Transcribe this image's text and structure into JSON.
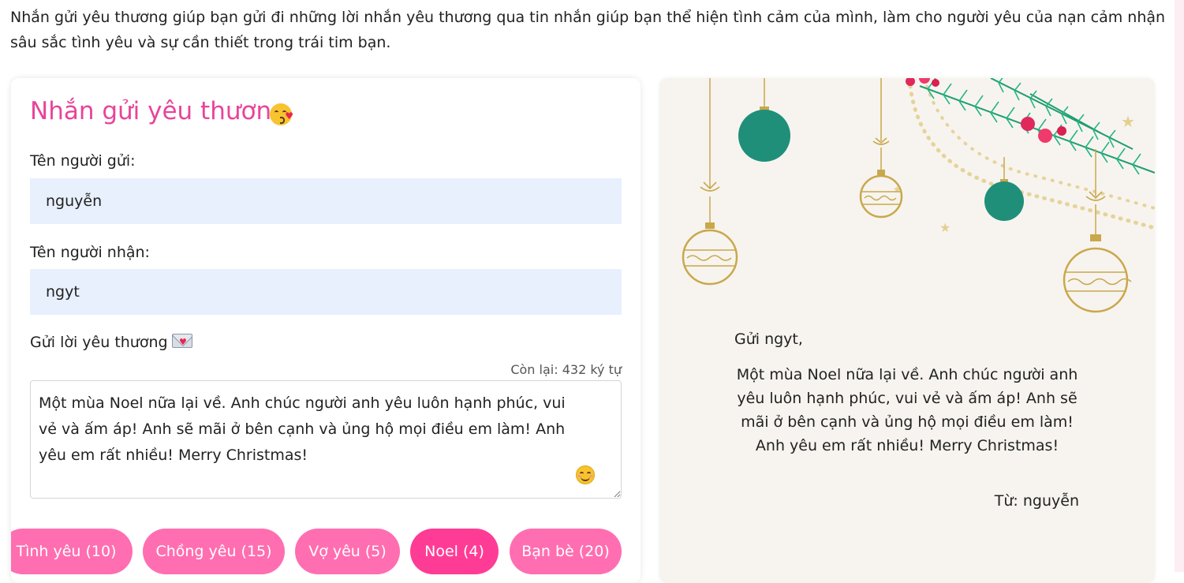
{
  "intro_text": "Nhắn gửi yêu thương giúp bạn gửi đi những lời nhắn yêu thương qua tin nhắn giúp bạn thể hiện tình cảm của mình, làm cho người yêu của nạn cảm nhận sâu sắc tình yêu và sự cần thiết trong trái tim bạn.",
  "form": {
    "title": "Nhắn gửi yêu thương",
    "title_emoji": "kissing-face-icon",
    "sender_label": "Tên người gửi:",
    "sender_value": "nguyễn",
    "receiver_label": "Tên người nhận:",
    "receiver_value": "ngyt",
    "message_label": "Gửi lời yêu thương",
    "message_icon": "love-letter-icon",
    "counter": "Còn lại: 432 ký tự",
    "message_value": "Một mùa Noel nữa lại về. Anh chúc người anh yêu luôn hạnh phúc, vui vẻ và ấm áp! Anh sẽ mãi ở bên cạnh và ủng hộ mọi điều em làm! Anh yêu em rất nhiều! Merry Christmas!",
    "emoji_button": "smiling-face-icon"
  },
  "categories": [
    {
      "label": "Tình yêu (10)",
      "active": false
    },
    {
      "label": "Chồng yêu (15)",
      "active": false
    },
    {
      "label": "Vợ yêu (5)",
      "active": false
    },
    {
      "label": "Noel (4)",
      "active": true
    },
    {
      "label": "Bạn bè (20)",
      "active": false
    }
  ],
  "preview": {
    "greeting": "Gửi ngyt,",
    "message": "Một mùa Noel nữa lại về. Anh chúc người anh yêu luôn hạnh phúc, vui vẻ và ấm áp! Anh sẽ mãi ở bên cạnh và ủng hộ mọi điều em làm! Anh yêu em rất nhiều! Merry Christmas!",
    "signature": "Từ: nguyễn",
    "decoration": "christmas-ornaments-icon"
  },
  "colors": {
    "accent": "#e8449a",
    "pill": "#ff6eb0",
    "pill_active": "#ff3c95",
    "input_bg": "#e8f0fe",
    "ornament_teal": "#1f8f7a",
    "ornament_gold": "#c9a84c"
  }
}
